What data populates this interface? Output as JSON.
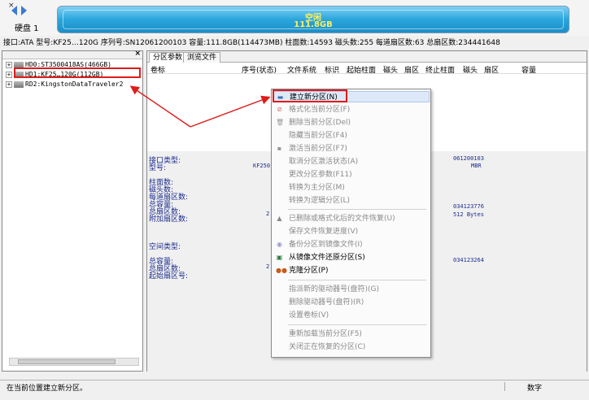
{
  "disk_header": {
    "close": "×",
    "disk_label": "硬盘 1",
    "free_label": "空闲",
    "free_size": "111.8GB",
    "info": "接口:ATA  型号:KF25…120G  序列号:SN12061200103  容量:111.8GB(114473MB)  柱面数:14593  磁头数:255  每道扇区数:63  总扇区数:234441648"
  },
  "tree": {
    "items": [
      "HD0:ST3500418AS(466GB)",
      "HD1:KF25…120G(112GB)",
      "RD2:KingstonDataTraveler2"
    ]
  },
  "tabs": [
    "分区参数",
    "浏览文件"
  ],
  "columns": [
    "卷标",
    "序号(状态)",
    "文件系统",
    "标识",
    "起始柱面",
    "磁头",
    "扇区",
    "终止柱面",
    "磁头",
    "扇区",
    "容量"
  ],
  "details": {
    "labels": [
      "接口类型:",
      "型号:",
      "柱面数:",
      "磁头数:",
      "每道扇区数:",
      "总容量:",
      "总扇区数:",
      "附加扇区数:",
      "空间类型:",
      "总容量:",
      "总扇区数:",
      "起始扇区号:"
    ],
    "values": [
      "KF250",
      "061200103",
      "MBR",
      "034123776",
      "512 Bytes",
      "2",
      "034123264",
      "2"
    ]
  },
  "context_menu": {
    "items": [
      {
        "label": "建立新分区(N)",
        "disabled": false,
        "active": true
      },
      {
        "label": "格式化当前分区(F)",
        "disabled": true
      },
      {
        "label": "删除当前分区(Del)",
        "disabled": true
      },
      {
        "label": "隐藏当前分区(F4)",
        "disabled": true
      },
      {
        "label": "激活当前分区(F7)",
        "disabled": true
      },
      {
        "label": "取消分区激活状态(A)",
        "disabled": true
      },
      {
        "label": "更改分区参数(F11)",
        "disabled": true
      },
      {
        "label": "转换为主分区(M)",
        "disabled": true
      },
      {
        "label": "转换为逻辑分区(L)",
        "disabled": true
      },
      {
        "label": "已删除或格式化后的文件恢复(U)",
        "disabled": true
      },
      {
        "label": "保存文件恢复进度(V)",
        "disabled": true
      },
      {
        "label": "备份分区到镜像文件(I)",
        "disabled": true
      },
      {
        "label": "从镜像文件还原分区(S)",
        "disabled": false
      },
      {
        "label": "克隆分区(P)",
        "disabled": false
      },
      {
        "label": "指派新的驱动器号(盘符)(G)",
        "disabled": true
      },
      {
        "label": "删除驱动器号(盘符)(R)",
        "disabled": true
      },
      {
        "label": "设置卷标(V)",
        "disabled": true
      },
      {
        "label": "重新加载当前分区(F5)",
        "disabled": true
      },
      {
        "label": "关闭正在恢复的分区(C)",
        "disabled": true
      }
    ]
  },
  "statusbar": {
    "text": "在当前位置建立新分区。",
    "mode": "数字"
  },
  "colors": {
    "highlight_red": "#e01b1b",
    "partition_blue": "#2aa6dc",
    "free_text": "#ffef5e"
  }
}
